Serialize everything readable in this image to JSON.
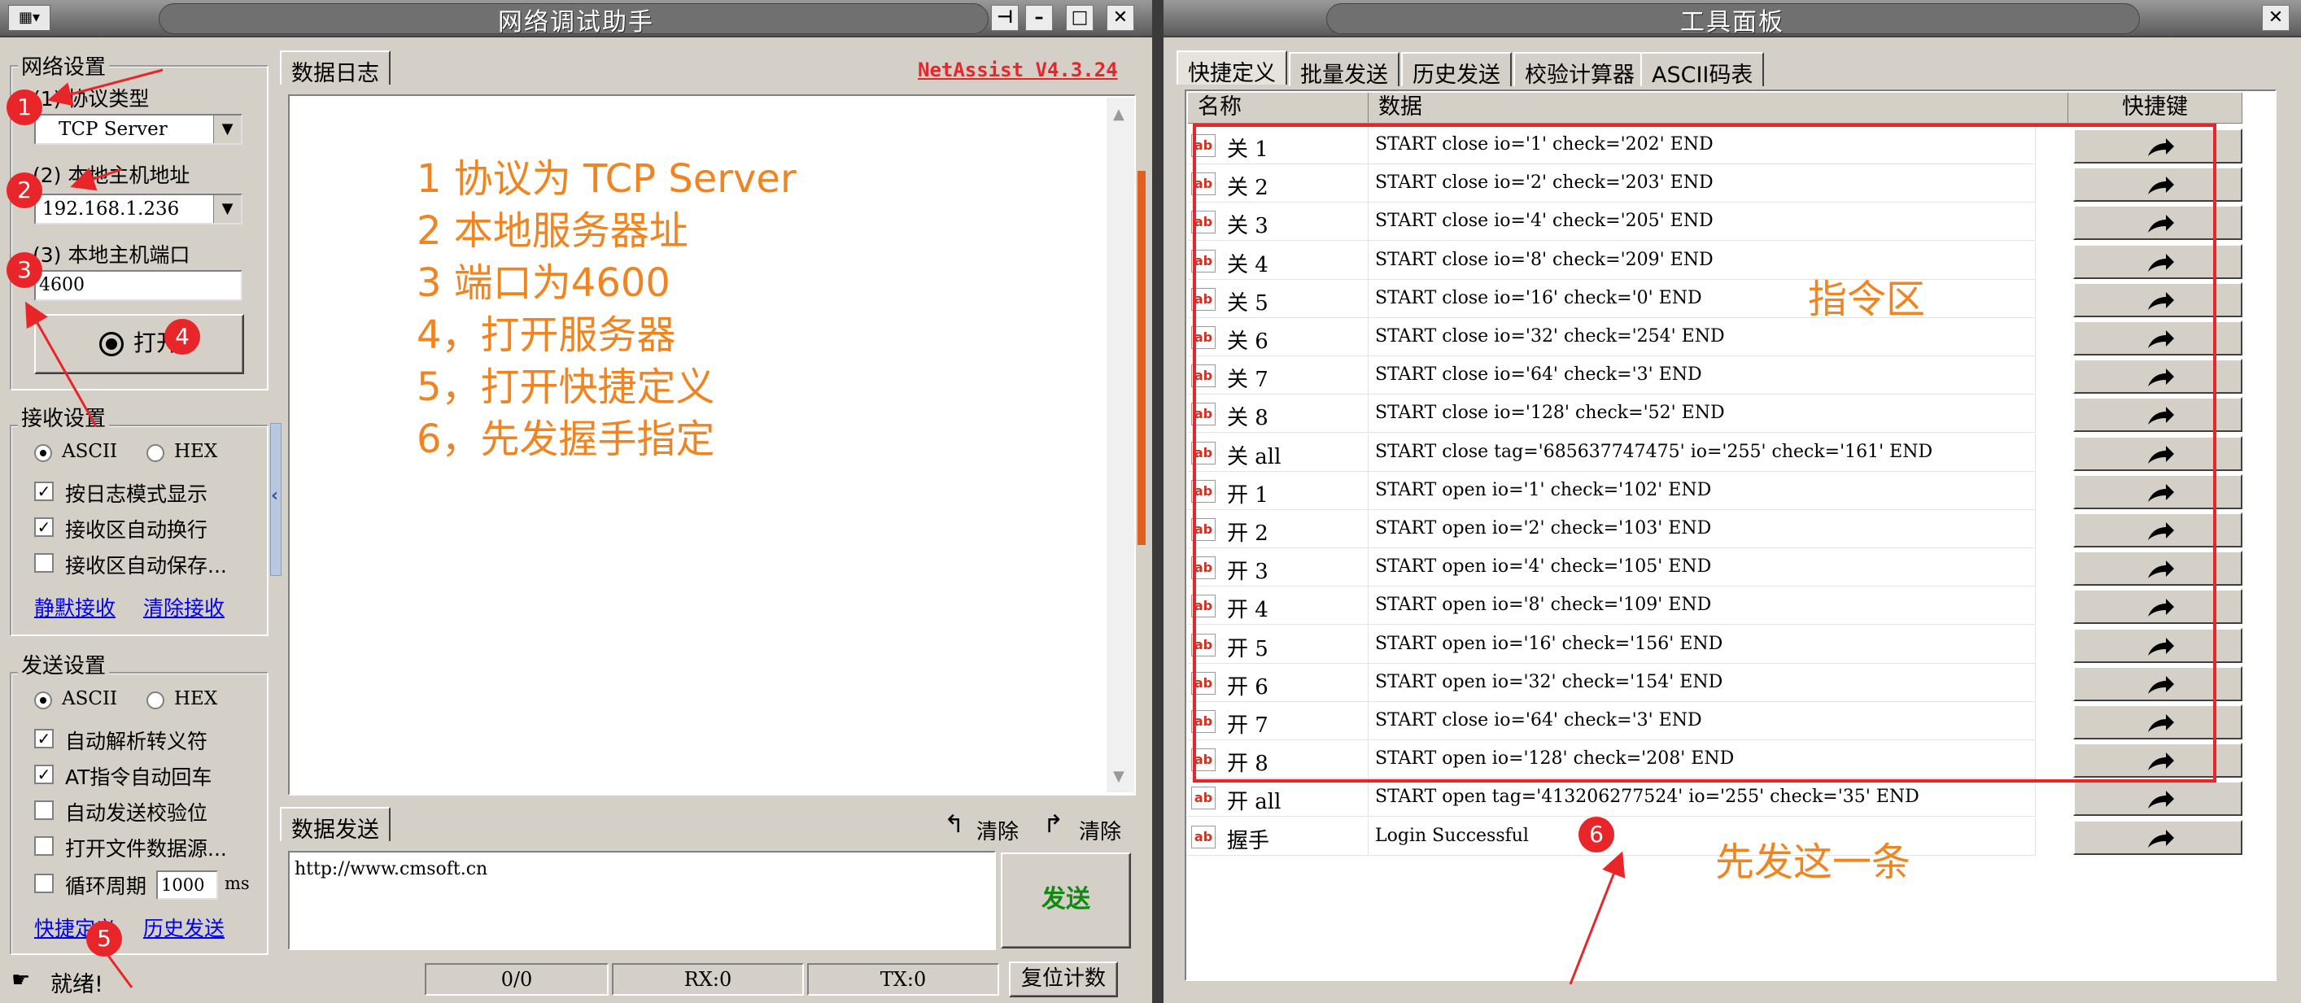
{
  "colors": {
    "annotation": "#f08420",
    "highlight_box": "#e8262a",
    "marker": "#e8262a",
    "link": "#0000ee",
    "version": "#e8262a"
  },
  "left_window": {
    "title": "网络调试助手",
    "title_buttons": [
      "pin-icon",
      "minimize-icon",
      "maximize-icon",
      "close-icon"
    ],
    "net_settings": {
      "label": "网络设置",
      "protocol_label": "(1) 协议类型",
      "protocol_value": "TCP Server",
      "host_label": "(2) 本地主机地址",
      "host_value": "192.168.1.236",
      "port_label": "(3) 本地主机端口",
      "port_value": "4600",
      "open_button": "打开"
    },
    "recv_settings": {
      "label": "接收设置",
      "ascii": "ASCII",
      "hex": "HEX",
      "opt1": "按日志模式显示",
      "opt2": "接收区自动换行",
      "opt3": "接收区自动保存...",
      "link1": "静默接收",
      "link2": "清除接收"
    },
    "send_settings": {
      "label": "发送设置",
      "ascii": "ASCII",
      "hex": "HEX",
      "opt1": "自动解析转义符",
      "opt2": "AT指令自动回车",
      "opt3": "自动发送校验位",
      "opt4": "打开文件数据源...",
      "opt5": "循环周期",
      "period": "1000",
      "period_unit": "ms",
      "link1": "快捷定义",
      "link2": "历史发送"
    },
    "log_tab": "数据日志",
    "version": "NetAssist V4.3.24",
    "send_tab": "数据发送",
    "clear1": "清除",
    "clear2": "清除",
    "send_text": "http://www.cmsoft.cn",
    "send_button": "发送",
    "status": {
      "text": "就绪!",
      "count": "0/0",
      "rx": "RX:0",
      "tx": "TX:0",
      "reset": "复位计数"
    }
  },
  "annotations": {
    "steps": [
      "1 协议为 TCP Server",
      "2 本地服务器址",
      "3  端口为4600",
      "4，打开服务器",
      "5，打开快捷定义",
      "6，先发握手指定"
    ],
    "zone": "指令区",
    "send_first": "先发这一条",
    "markers": [
      "1",
      "2",
      "3",
      "4",
      "5",
      "6"
    ]
  },
  "right_window": {
    "title": "工具面板",
    "tabs": [
      "快捷定义",
      "批量发送",
      "历史发送",
      "校验计算器",
      "ASCII码表"
    ],
    "columns": [
      "名称",
      "数据",
      "快捷键"
    ],
    "rows": [
      {
        "name": "关 1",
        "data": "START close io='1' check='202' END"
      },
      {
        "name": "关 2",
        "data": "START close io='2' check='203' END"
      },
      {
        "name": "关 3",
        "data": "START close io='4' check='205' END"
      },
      {
        "name": "关 4",
        "data": "START close io='8' check='209' END"
      },
      {
        "name": "关 5",
        "data": "START close io='16' check='0' END"
      },
      {
        "name": "关 6",
        "data": "START close io='32' check='254' END"
      },
      {
        "name": "关 7",
        "data": "START close io='64' check='3' END"
      },
      {
        "name": "关 8",
        "data": "START close io='128' check='52' END"
      },
      {
        "name": "关 all",
        "data": "START close tag='685637747475' io='255' check='161' END"
      },
      {
        "name": "开 1",
        "data": "START open io='1' check='102' END"
      },
      {
        "name": "开 2",
        "data": "START open io='2' check='103' END"
      },
      {
        "name": "开 3",
        "data": "START open io='4' check='105' END"
      },
      {
        "name": "开 4",
        "data": "START open io='8' check='109' END"
      },
      {
        "name": "开 5",
        "data": "START open io='16' check='156' END"
      },
      {
        "name": "开 6",
        "data": "START open io='32' check='154' END"
      },
      {
        "name": "开 7",
        "data": "START close io='64' check='3' END"
      },
      {
        "name": "开 8",
        "data": "START open io='128' check='208' END"
      },
      {
        "name": "开 all",
        "data": "START open tag='413206277524' io='255' check='35' END"
      },
      {
        "name": "握手",
        "data": "Login Successful"
      }
    ]
  }
}
